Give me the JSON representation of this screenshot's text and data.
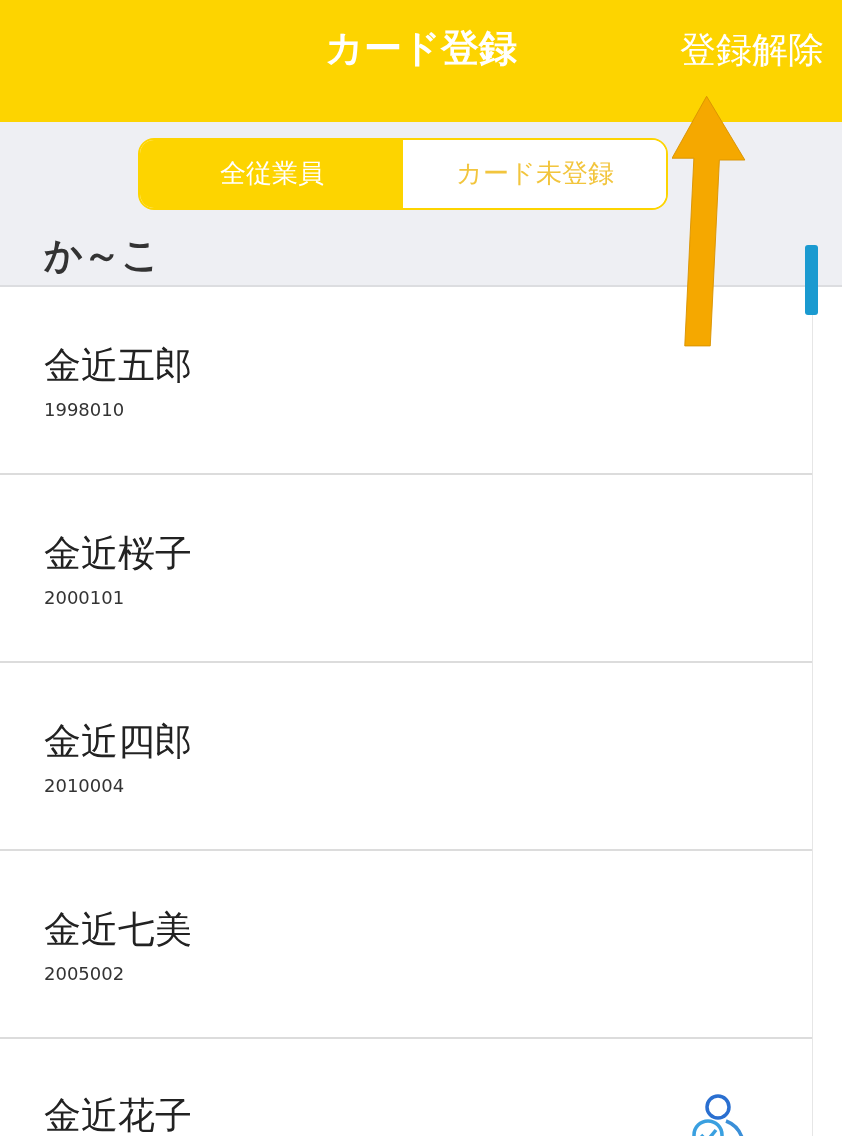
{
  "header": {
    "title": "カード登録",
    "action": "登録解除"
  },
  "segments": [
    {
      "label": "全従業員",
      "selected": true
    },
    {
      "label": "カード未登録",
      "selected": false
    }
  ],
  "section": {
    "title": "か～こ"
  },
  "employees": [
    {
      "name": "金近五郎",
      "id": "1998010",
      "registered": false
    },
    {
      "name": "金近桜子",
      "id": "2000101",
      "registered": false
    },
    {
      "name": "金近四郎",
      "id": "2010004",
      "registered": false
    },
    {
      "name": "金近七美",
      "id": "2005002",
      "registered": false
    },
    {
      "name": "金近花子",
      "registered": true
    }
  ]
}
